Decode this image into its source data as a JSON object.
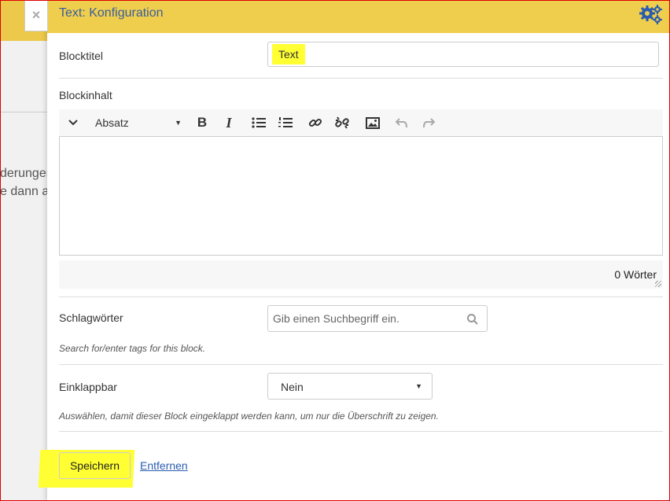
{
  "background": {
    "snippet_1": "derungen",
    "snippet_2": "e dann a"
  },
  "close_glyph": "×",
  "panel": {
    "title": "Text: Konfiguration",
    "config_icon": "gears-icon"
  },
  "form": {
    "block_title_label": "Blocktitel",
    "block_title_value": "Text",
    "block_content_label": "Blockinhalt",
    "editor": {
      "collapse_glyph": "⌄",
      "format_select": "Absatz",
      "bold": "B",
      "italic": "I",
      "word_count": "0 Wörter"
    },
    "tags_label": "Schlagwörter",
    "tags_placeholder": "Gib einen Suchbegriff ein.",
    "tags_hint": "Search for/enter tags for this block.",
    "collapsible_label": "Einklappbar",
    "collapsible_value": "Nein",
    "collapsible_hint": "Auswählen, damit dieser Block eingeklappt werden kann, um nur die Überschrift zu zeigen.",
    "save_label": "Speichern",
    "remove_label": "Entfernen"
  }
}
